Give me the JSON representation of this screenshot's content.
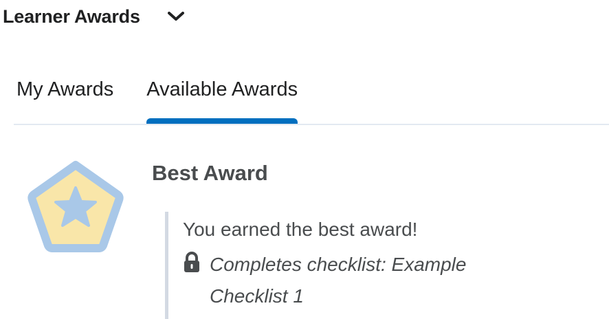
{
  "header": {
    "title": "Learner Awards"
  },
  "tabs": [
    {
      "label": "My Awards",
      "active": false
    },
    {
      "label": "Available Awards",
      "active": true
    }
  ],
  "award": {
    "icon": "star-pentagon-badge-icon",
    "title": "Best Award",
    "description": "You earned the best award!",
    "criteria": "Completes checklist: Example Checklist 1",
    "colors": {
      "badge_border": "#a9c8e8",
      "badge_fill": "#f9e6a9",
      "badge_star": "#a9c8e8"
    }
  },
  "colors": {
    "tab_active_indicator": "#006fbf",
    "divider": "#e3e9f1",
    "detail_rule": "#d3d9e3"
  }
}
